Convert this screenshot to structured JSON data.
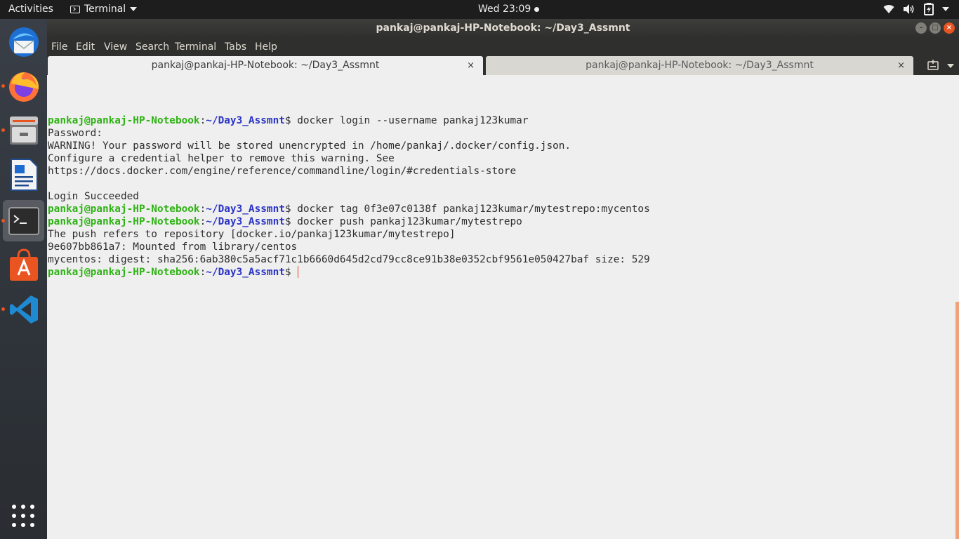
{
  "topbar": {
    "activities": "Activities",
    "app_menu": "Terminal",
    "clock": "Wed 23:09",
    "tray_icons": [
      "wifi-icon",
      "volume-icon",
      "battery-icon",
      "chevron-down-icon"
    ]
  },
  "dock": {
    "items": [
      {
        "name": "thunderbird-icon",
        "running": false,
        "active": false
      },
      {
        "name": "firefox-icon",
        "running": true,
        "active": false
      },
      {
        "name": "files-icon",
        "running": true,
        "active": false
      },
      {
        "name": "writer-icon",
        "running": false,
        "active": false
      },
      {
        "name": "terminal-icon",
        "running": true,
        "active": true
      },
      {
        "name": "software-icon",
        "running": false,
        "active": false
      },
      {
        "name": "vscode-icon",
        "running": true,
        "active": false
      }
    ],
    "show_apps": "apps-grid-icon"
  },
  "window": {
    "title": "pankaj@pankaj-HP-Notebook: ~/Day3_Assmnt",
    "menu": [
      "File",
      "Edit",
      "View",
      "Search",
      "Terminal",
      "Tabs",
      "Help"
    ],
    "tabs": [
      {
        "label": "pankaj@pankaj-HP-Notebook: ~/Day3_Assmnt",
        "active": true
      },
      {
        "label": "pankaj@pankaj-HP-Notebook: ~/Day3_Assmnt",
        "active": false
      }
    ],
    "tab_close": "×",
    "buttons": {
      "minimize": "–",
      "maximize": "□",
      "close": "×"
    }
  },
  "terminal": {
    "user_host": "pankaj@pankaj-HP-Notebook",
    "path": "~/Day3_Assmnt",
    "lines": [
      {
        "type": "blank"
      },
      {
        "type": "prompt",
        "cmd": " docker login --username pankaj123kumar"
      },
      {
        "type": "out",
        "text": "Password:"
      },
      {
        "type": "out",
        "text": "WARNING! Your password will be stored unencrypted in /home/pankaj/.docker/config.json."
      },
      {
        "type": "out",
        "text": "Configure a credential helper to remove this warning. See"
      },
      {
        "type": "out",
        "text": "https://docs.docker.com/engine/reference/commandline/login/#credentials-store"
      },
      {
        "type": "blank"
      },
      {
        "type": "out",
        "text": "Login Succeeded"
      },
      {
        "type": "prompt",
        "cmd": " docker tag 0f3e07c0138f pankaj123kumar/mytestrepo:mycentos"
      },
      {
        "type": "prompt",
        "cmd": " docker push pankaj123kumar/mytestrepo"
      },
      {
        "type": "out",
        "text": "The push refers to repository [docker.io/pankaj123kumar/mytestrepo]"
      },
      {
        "type": "out",
        "text": "9e607bb861a7: Mounted from library/centos"
      },
      {
        "type": "out",
        "text": "mycentos: digest: sha256:6ab380c5a5acf71c1b6660d645d2cd79cc8ce91b38e0352cbf9561e050427baf size: 529"
      },
      {
        "type": "prompt",
        "cmd": " ",
        "cursor": true
      }
    ]
  },
  "colors": {
    "prompt_user": "#2eb315",
    "prompt_path": "#2a34c4",
    "accent": "#e95420"
  }
}
